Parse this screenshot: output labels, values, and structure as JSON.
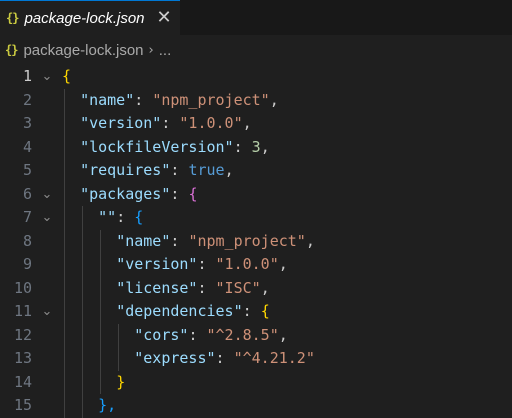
{
  "tab": {
    "icon": "{}",
    "label": "package-lock.json",
    "close": "✕"
  },
  "breadcrumb": {
    "icon": "{}",
    "file": "package-lock.json",
    "separator": "›",
    "more": "..."
  },
  "lines": [
    "1",
    "2",
    "3",
    "4",
    "5",
    "6",
    "7",
    "8",
    "9",
    "10",
    "11",
    "12",
    "13",
    "14",
    "15"
  ],
  "code": {
    "l1_open": "{",
    "l2_key": "\"name\"",
    "l2_val": "\"npm_project\"",
    "l3_key": "\"version\"",
    "l3_val": "\"1.0.0\"",
    "l4_key": "\"lockfileVersion\"",
    "l4_val": "3",
    "l5_key": "\"requires\"",
    "l5_val": "true",
    "l6_key": "\"packages\"",
    "l6_open": "{",
    "l7_key": "\"\"",
    "l7_open": "{",
    "l8_key": "\"name\"",
    "l8_val": "\"npm_project\"",
    "l9_key": "\"version\"",
    "l9_val": "\"1.0.0\"",
    "l10_key": "\"license\"",
    "l10_val": "\"ISC\"",
    "l11_key": "\"dependencies\"",
    "l11_open": "{",
    "l12_key": "\"cors\"",
    "l12_val": "\"^2.8.5\"",
    "l13_key": "\"express\"",
    "l13_val": "\"^4.21.2\"",
    "l14_close": "}",
    "l15_close": "},"
  },
  "colors": {
    "background": "#1f1f1f",
    "key": "#9cdcfe",
    "string": "#ce9178",
    "number": "#b5cea8",
    "boolean": "#569cd6",
    "bracket_level1": "#ffd700",
    "bracket_level2": "#da70d6",
    "bracket_level3": "#179fff"
  }
}
